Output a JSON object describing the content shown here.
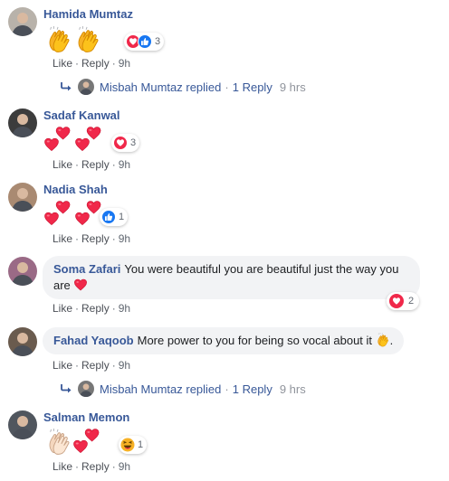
{
  "actions": {
    "like": "Like",
    "reply": "Reply",
    "dot": "·"
  },
  "comments": [
    {
      "name": "Hamida Mumtaz",
      "time": "9h",
      "reaction_count": "3",
      "reactions": [
        "love",
        "like"
      ],
      "emojis": [
        "clap",
        "clap"
      ]
    },
    {
      "name": "Sadaf Kanwal",
      "time": "9h",
      "reaction_count": "3",
      "reactions": [
        "love"
      ],
      "emojis": [
        "hearts",
        "hearts"
      ]
    },
    {
      "name": "Nadia Shah",
      "time": "9h",
      "reaction_count": "1",
      "reactions": [
        "like"
      ],
      "emojis": [
        "hearts",
        "hearts"
      ]
    },
    {
      "name": "Soma Zafari",
      "text": "You were beautiful you are beautiful just the way you are",
      "time": "9h",
      "reaction_count": "2",
      "reactions": [
        "love"
      ],
      "emojis": [
        "heart-inline"
      ]
    },
    {
      "name": "Fahad Yaqoob",
      "text": "More power to you for being so vocal about it",
      "text_suffix": ".",
      "time": "9h",
      "emojis": [
        "clap-inline"
      ]
    },
    {
      "name": "Salman Memon",
      "time": "9h",
      "reaction_count": "1",
      "reactions": [
        "haha"
      ],
      "emojis": [
        "clap-light",
        "hearts"
      ]
    }
  ],
  "replies": [
    {
      "who": "Misbah Mumtaz replied",
      "count": "1 Reply",
      "time": "9 hrs"
    },
    {
      "who": "Misbah Mumtaz replied",
      "count": "1 Reply",
      "time": "9 hrs"
    }
  ],
  "colors": {
    "link": "#385898",
    "meta": "#606770",
    "bubble": "#f2f3f5",
    "love": "#f0284a",
    "like": "#1877f2",
    "haha": "#f7b125"
  }
}
